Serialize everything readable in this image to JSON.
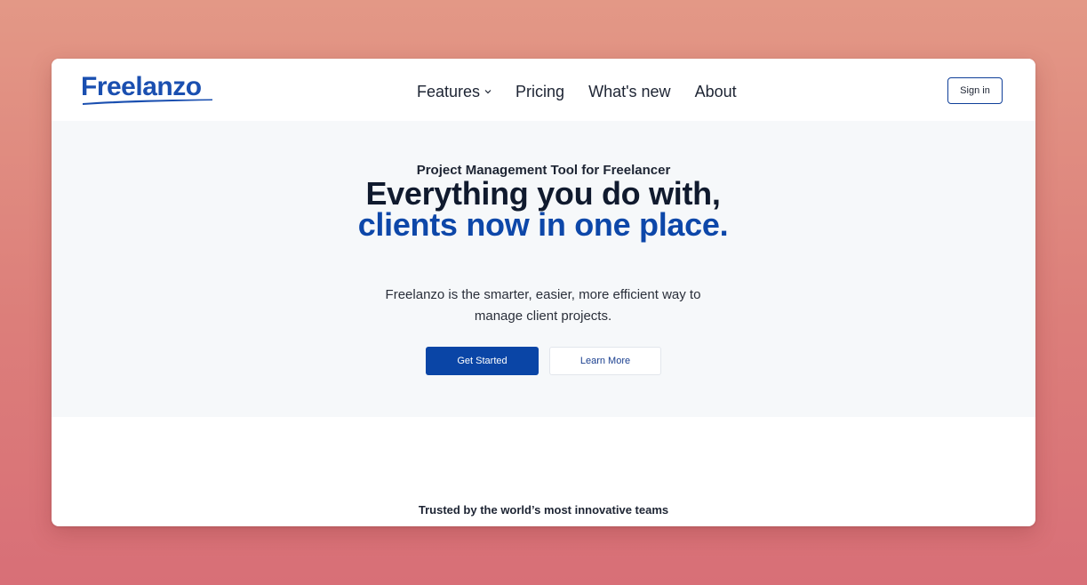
{
  "brand": {
    "name": "Freelanzo",
    "color": "#1a4fb0"
  },
  "nav": {
    "items": [
      {
        "label": "Features",
        "has_dropdown": true
      },
      {
        "label": "Pricing",
        "has_dropdown": false
      },
      {
        "label": "What's new",
        "has_dropdown": false
      },
      {
        "label": "About",
        "has_dropdown": false
      }
    ],
    "signin_label": "Sign in"
  },
  "hero": {
    "eyebrow": "Project Management Tool for Freelancer",
    "headline_dark": "Everything you do with,",
    "headline_blue": "clients now in one place.",
    "subtext": "Freelanzo is the smarter, easier, more efficient way to manage client projects.",
    "primary_cta": "Get Started",
    "secondary_cta": "Learn More"
  },
  "trusted": {
    "label": "Trusted by the world’s most innovative teams"
  },
  "colors": {
    "accent": "#0a45a6",
    "heading": "#101a2e",
    "hero_bg": "#f6f8fa",
    "page_bg_top": "#e39886",
    "page_bg_bottom": "#d86f77"
  },
  "icons": {
    "features_dropdown": "chevron-down-icon"
  }
}
